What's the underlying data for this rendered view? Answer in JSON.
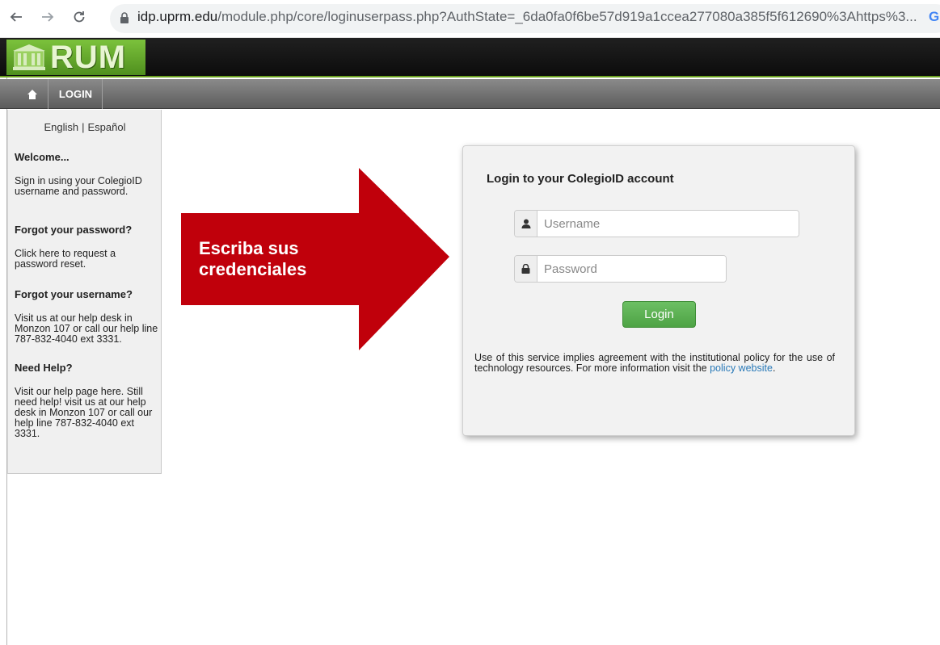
{
  "browser": {
    "url_host": "idp.uprm.edu",
    "url_path": "/module.php/core/loginuserpass.php?AuthState=_6da0fa0f6be57d919a1ccea277080a385f5f612690%3Ahttps%3...",
    "extension_letter": "G"
  },
  "site": {
    "logo_text": "RUM",
    "menu": {
      "login_label": "LOGIN"
    }
  },
  "sidebar": {
    "lang_english": "English",
    "lang_sep": "|",
    "lang_spanish": "Español",
    "welcome_heading": "Welcome...",
    "welcome_text": "Sign in using your ColegioID username and password.",
    "forgot_password_heading": "Forgot your password?",
    "forgot_password_text": "Click  here to request a password reset.",
    "forgot_username_heading": "Forgot your username?",
    "forgot_username_text": "Visit us at our help desk in Monzon 107 or call our help line 787-832-4040 ext 3331.",
    "need_help_heading": "Need Help?",
    "need_help_text": "Visit our help page  here. Still need help! visit us at our help desk in Monzon 107 or call our help line 787-832-4040 ext 3331."
  },
  "annotation": {
    "line1": "Escriba sus",
    "line2": "credenciales",
    "color": "#c0000b"
  },
  "login_card": {
    "title": "Login to your ColegioID account",
    "username_placeholder": "Username",
    "password_placeholder": "Password",
    "login_button": "Login",
    "notice_text": "Use of this service implies agreement with the institutional policy for the use of technology resources. For more information visit the ",
    "policy_link": "policy website",
    "notice_end": "."
  },
  "icons": {
    "back": "back-arrow-icon",
    "forward": "forward-arrow-icon",
    "reload": "reload-icon",
    "lock": "lock-icon",
    "home": "home-icon",
    "user": "user-icon",
    "password": "padlock-icon"
  },
  "colors": {
    "brand_green": "#6aa020",
    "button_green": "#5cb85c",
    "link_blue": "#2a7ab8",
    "arrow_red": "#c0000b"
  }
}
